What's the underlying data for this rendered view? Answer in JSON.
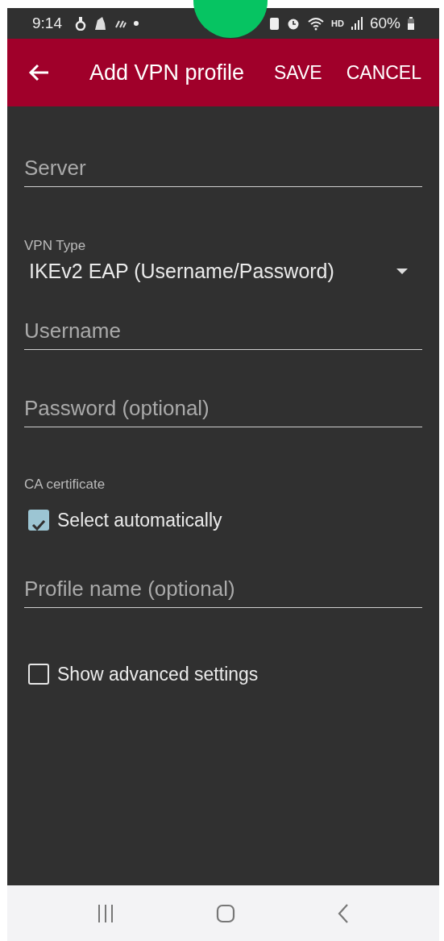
{
  "status_bar": {
    "time": "9:14",
    "hd": "HD",
    "battery": "60%"
  },
  "header": {
    "title": "Add VPN profile",
    "actions": [
      "SAVE",
      "CANCEL"
    ]
  },
  "fields": [
    {
      "kind": "input",
      "placeholder": "Server"
    },
    {
      "kind": "select",
      "label": "VPN Type",
      "value": "IKEv2 EAP (Username/Password)"
    },
    {
      "kind": "input",
      "placeholder": "Username"
    },
    {
      "kind": "input",
      "placeholder": "Password (optional)"
    },
    {
      "kind": "checkbox",
      "label": "CA certificate",
      "text": "Select automatically",
      "checked": true
    },
    {
      "kind": "input",
      "placeholder": "Profile name (optional)"
    },
    {
      "kind": "checkbox",
      "text": "Show advanced settings",
      "checked": false
    }
  ]
}
